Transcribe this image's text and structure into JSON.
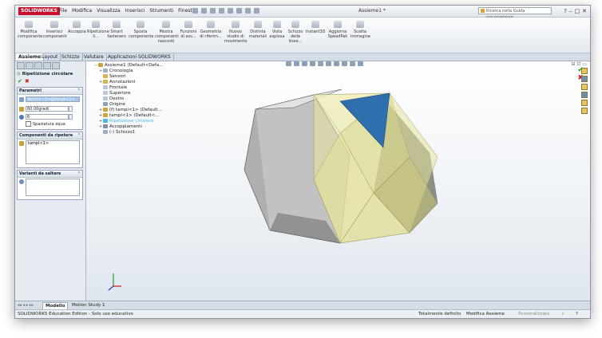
{
  "app": {
    "logo_text": "SOLIDWORKS",
    "document_title": "Assieme1 *"
  },
  "menu": [
    "File",
    "Modifica",
    "Visualizza",
    "Inserisci",
    "Strumenti",
    "Finestra",
    "?"
  ],
  "search": {
    "placeholder": "Ricerca nella Guida SOLIDWORKS"
  },
  "ribbon": {
    "buttons": [
      {
        "label": "Modifica componente"
      },
      {
        "label": "Inserisci componenti"
      },
      {
        "label": "Accoppia"
      },
      {
        "label": "Ripetizione li..."
      },
      {
        "label": "Smart fasteners"
      },
      {
        "label": "Sposta componente"
      },
      {
        "label": "Mostra componenti nascosti"
      },
      {
        "label": "Funzioni di ass..."
      },
      {
        "label": "Geometria di riferim..."
      },
      {
        "label": "Nuovo studio di movimento"
      },
      {
        "label": "Distinta materiali"
      },
      {
        "label": "Vista esplosa"
      },
      {
        "label": "Schizzo delle linee..."
      },
      {
        "label": "Instant3D"
      },
      {
        "label": "Aggiorna SpeedPak"
      },
      {
        "label": "Scatta immagine"
      }
    ]
  },
  "tabs": [
    "Assieme",
    "Layout",
    "Schizzo",
    "Valutare",
    "Applicazioni SOLIDWORKS"
  ],
  "property_manager": {
    "title": "Ripetizione circolare",
    "parameters": {
      "header": "Parametri",
      "axis_value": "Vertice<1>@tampl<1>",
      "angle_value": "60.00gradi",
      "instances_value": "6",
      "equal_spacing_label": "Spaziatura equa"
    },
    "components": {
      "header": "Componenti da ripetere",
      "item": "tampl<1>"
    },
    "skip": {
      "header": "Varianti da saltare"
    }
  },
  "tree": {
    "items": [
      {
        "label": "Assieme1 (Default<Defa...",
        "icon": "assembly-icon"
      },
      {
        "label": "Cronologia",
        "icon": "history-icon"
      },
      {
        "label": "Sensori",
        "icon": "sensor-icon"
      },
      {
        "label": "Annotazioni",
        "icon": "annotation-icon"
      },
      {
        "label": "Frontale",
        "icon": "plane-icon"
      },
      {
        "label": "Superiore",
        "icon": "plane-icon"
      },
      {
        "label": "Destro",
        "icon": "plane-icon"
      },
      {
        "label": "Origine",
        "icon": "origin-icon"
      },
      {
        "label": "(f) tampl<1> (Default...",
        "icon": "part-icon"
      },
      {
        "label": "tampl<1> (Default<...",
        "icon": "part-icon"
      },
      {
        "label": "Ripetizione circolare",
        "icon": "pattern-icon"
      },
      {
        "label": "Accoppiamenti",
        "icon": "mates-icon"
      },
      {
        "label": "(-) Schizzo1",
        "icon": "sketch-icon"
      }
    ]
  },
  "bottom_tabs": [
    "Modello",
    "Motion Study 1"
  ],
  "status": {
    "left": "SOLIDWORKS Education Edition - Solo uso educativo",
    "state": "Totalmente definito",
    "mode": "Modifica Assieme",
    "custom": "Personalizzato"
  },
  "colors": {
    "hex_gray": "#b9b9b9",
    "yellow_transparent": "#e8e6a0",
    "blue_face": "#2f6fad",
    "accent_red": "#c8102e"
  }
}
